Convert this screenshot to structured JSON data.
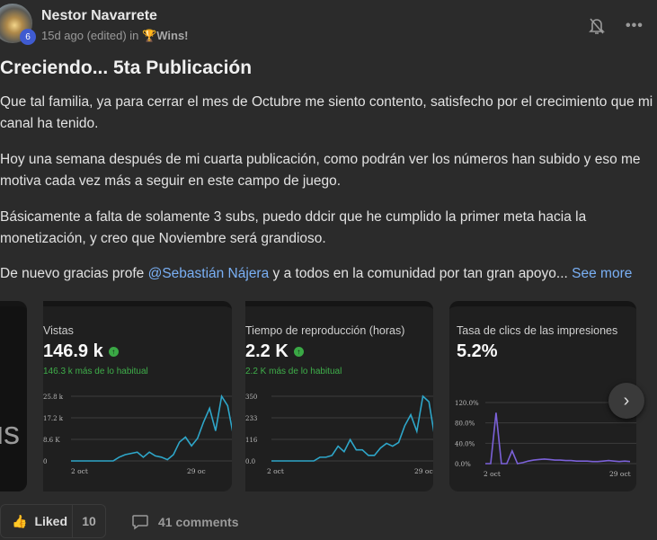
{
  "post": {
    "author": "Nestor Navarrete",
    "level": "6",
    "time": "15d ago (edited) in",
    "category": "Wins!",
    "title": "Creciendo... 5ta Publicación",
    "paragraphs": [
      "Que tal familia, ya para cerrar el mes de Octubre me siento contento, satisfecho por el crecimiento que mi canal ha tenido.",
      "Hoy una semana después de mi cuarta publicación, como podrán ver los números han subido y eso me motiva cada vez más a seguir en este campo de juego.",
      "Básicamente a falta de solamente 3 subs, puedo ddcir que he cumplido la primer meta hacia la monetización, y creo que Noviembre será grandioso."
    ],
    "last_pre": "De nuevo gracias profe ",
    "mention": "@Sebastián Nájera",
    "last_post": " y a todos en la comunidad por tan gran apoyo... ",
    "see_more": "See more",
    "partial_card_text": "us"
  },
  "icons": {
    "bell": "bell-off-icon",
    "more": "more-horizontal-icon",
    "trophy": "trophy-icon",
    "like": "thumbs-up-icon",
    "comment": "comment-icon",
    "next": "chevron-right-icon"
  },
  "colors": {
    "line": "#2ea6c9",
    "ctr_line": "#7b61d8",
    "positive": "#3fae4a",
    "accent_link": "#7ab0f5"
  },
  "footer": {
    "liked": "Liked",
    "likes": "10",
    "comments": "41 comments"
  },
  "chart_data": [
    {
      "type": "line",
      "title": "Vistas",
      "value": "146.9 k",
      "delta": "146.3 k más de lo habitual",
      "ylim": [
        0,
        25800
      ],
      "yticks": [
        "0",
        "8.6 K",
        "17.2 k",
        "25.8 k"
      ],
      "xticks": [
        "2 oct",
        "29 oc"
      ],
      "grid": true,
      "values": [
        0,
        0,
        0,
        0,
        0,
        0,
        0,
        0,
        1500,
        2500,
        3000,
        3500,
        1500,
        3500,
        2000,
        1500,
        500,
        2500,
        7500,
        9500,
        6000,
        9000,
        15500,
        21000,
        12000,
        25800,
        22000,
        9500
      ]
    },
    {
      "type": "line",
      "title": "Tiempo de reproducción (horas)",
      "value": "2.2 K",
      "delta": "2.2 K más de lo habitual",
      "ylim": [
        0,
        350
      ],
      "yticks": [
        "0.0",
        "116",
        "233",
        "350"
      ],
      "xticks": [
        "2 oct",
        "29 oc"
      ],
      "grid": true,
      "values": [
        0,
        0,
        0,
        0,
        0,
        0,
        0,
        0,
        20,
        20,
        30,
        80,
        50,
        115,
        60,
        60,
        30,
        30,
        70,
        95,
        80,
        100,
        190,
        250,
        160,
        350,
        320,
        120
      ]
    },
    {
      "type": "line",
      "title": "Tasa de clics de las impresiones",
      "value": "5.2%",
      "ylim": [
        0,
        120
      ],
      "yticks": [
        "0.0%",
        "40.0%",
        "80.0%",
        "120.0%"
      ],
      "xticks": [
        "2 oct",
        "29 oct"
      ],
      "grid": true,
      "values": [
        0,
        0,
        100,
        0,
        0,
        25,
        0,
        2,
        5,
        7,
        8,
        9,
        8,
        7,
        7,
        6,
        6,
        5,
        5,
        5,
        4,
        4,
        5,
        6,
        5,
        4,
        5,
        4
      ]
    }
  ]
}
